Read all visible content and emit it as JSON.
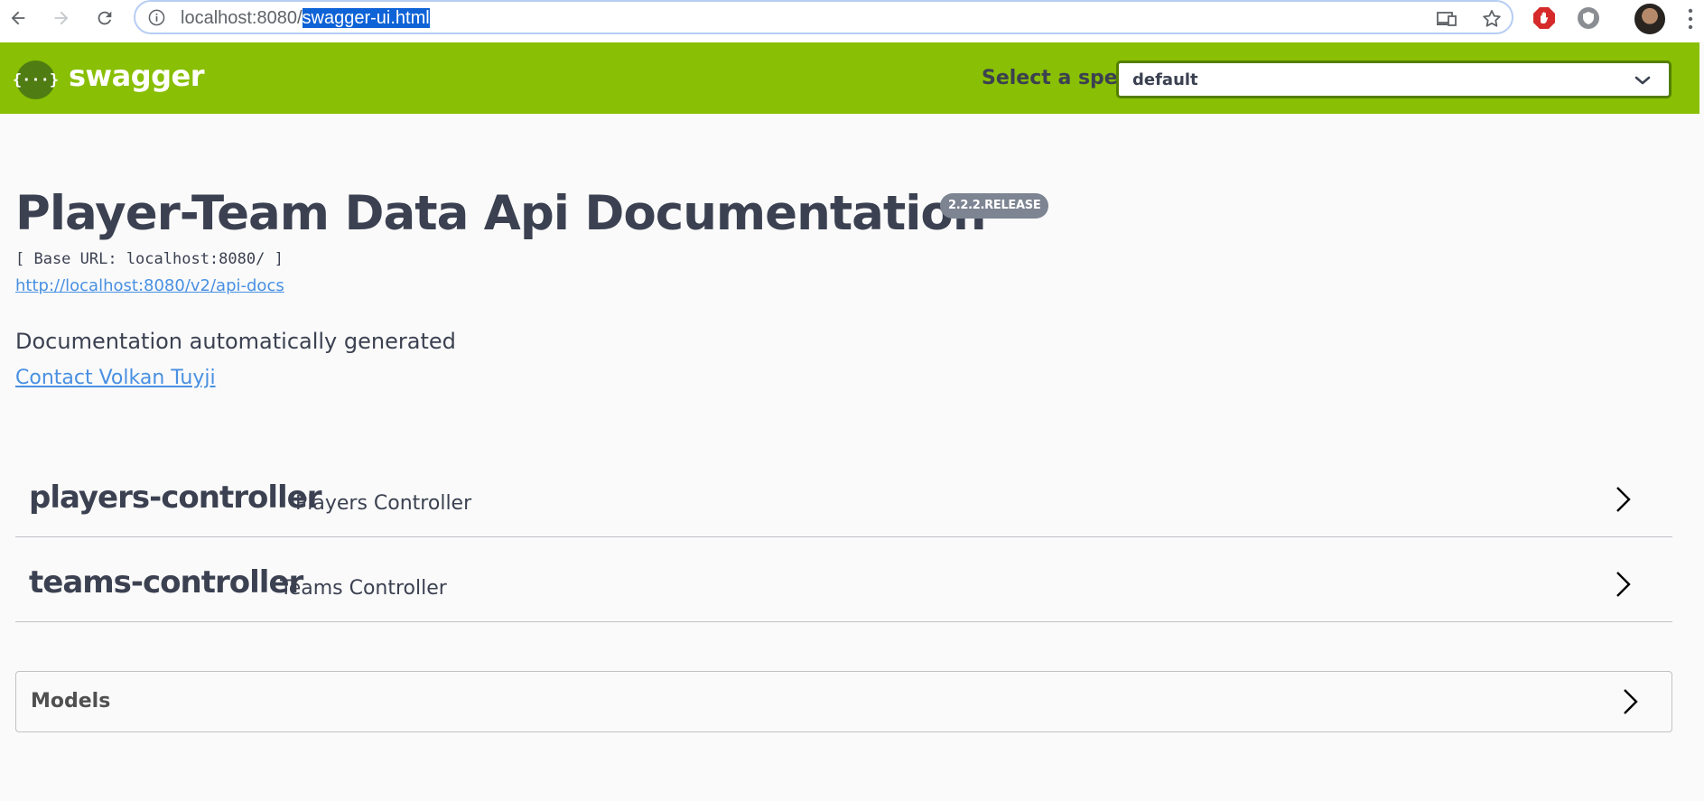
{
  "browser": {
    "url_host": "localhost:8080/",
    "url_path": "swagger-ui.html"
  },
  "topbar": {
    "logo_mark": "{···}",
    "brand": "swagger",
    "spec_label": "Select a spec",
    "spec_selected": "default"
  },
  "info": {
    "title": "Player-Team Data Api Documentation",
    "version": "2.2.2.RELEASE",
    "base_url": "[ Base URL: localhost:8080/ ]",
    "spec_link": "http://localhost:8080/v2/api-docs",
    "description": "Documentation automatically generated",
    "contact": "Contact Volkan Tuyji"
  },
  "tags": [
    {
      "name": "players-controller",
      "description": "Players Controller"
    },
    {
      "name": "teams-controller",
      "description": "Teams Controller"
    }
  ],
  "models": {
    "title": "Models"
  },
  "colors": {
    "topbar": "#89bf04",
    "link": "#4990e2",
    "text": "#3b4151",
    "badge": "#7d8492"
  }
}
